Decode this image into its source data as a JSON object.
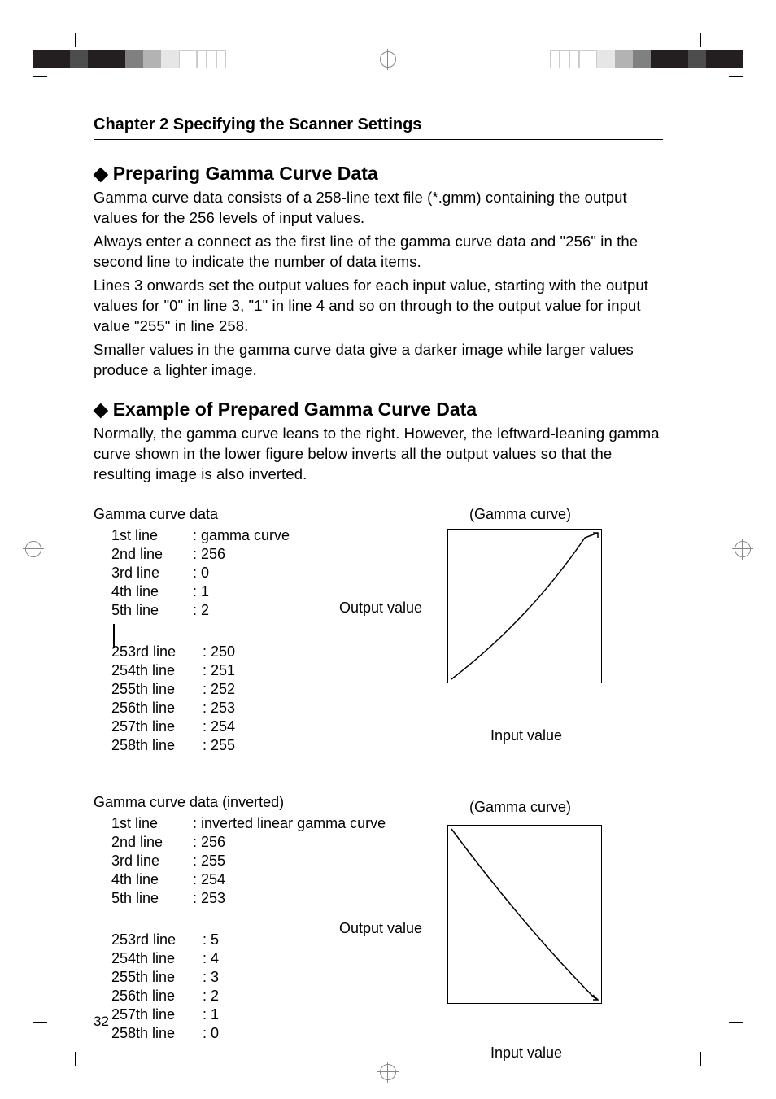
{
  "header": {
    "chapter_title": "Chapter 2 Specifying the Scanner Settings"
  },
  "section1": {
    "heading": "Preparing Gamma Curve Data",
    "p1": "Gamma curve data consists of a 258-line text file (*.gmm) containing the output values for the 256 levels of input values.",
    "p2": "Always enter a connect as the first line of the gamma curve data and \"256\" in the second line to indicate the number of data items.",
    "p3": "Lines 3 onwards set the output values for each input value, starting with the output values for \"0\" in line 3, \"1\" in line 4 and so on through to the output value for input value \"255\" in line 258.",
    "p4": "Smaller values in the gamma curve data give a darker image while larger values produce a lighter image."
  },
  "section2": {
    "heading": "Example of Prepared Gamma Curve Data",
    "p1": "Normally, the gamma curve leans to the right. However, the leftward-leaning gamma curve shown in the lower figure below inverts all the output values so that the resulting image is also inverted."
  },
  "fig1": {
    "title": "Gamma curve data",
    "curve_label": "(Gamma curve)",
    "out_label": "Output value",
    "in_label": "Input value",
    "lines_top": [
      {
        "k": "1st line",
        "v": "gamma curve"
      },
      {
        "k": "2nd line",
        "v": "256"
      },
      {
        "k": "3rd line",
        "v": "0"
      },
      {
        "k": "4th line",
        "v": "1"
      },
      {
        "k": "5th line",
        "v": "2"
      }
    ],
    "lines_bottom": [
      {
        "k": "253rd line",
        "v": "250"
      },
      {
        "k": "254th line",
        "v": "251"
      },
      {
        "k": "255th line",
        "v": "252"
      },
      {
        "k": "256th line",
        "v": "253"
      },
      {
        "k": "257th line",
        "v": "254"
      },
      {
        "k": "258th line",
        "v": "255"
      }
    ]
  },
  "fig2": {
    "title": "Gamma curve data (inverted)",
    "curve_label": "(Gamma curve)",
    "out_label": "Output value",
    "in_label": "Input value",
    "lines_top": [
      {
        "k": "1st line",
        "v": "inverted linear gamma curve"
      },
      {
        "k": "2nd line",
        "v": "256"
      },
      {
        "k": "3rd line",
        "v": "255"
      },
      {
        "k": "4th line",
        "v": "254"
      },
      {
        "k": "5th line",
        "v": "253"
      }
    ],
    "lines_bottom": [
      {
        "k": "253rd line",
        "v": "5"
      },
      {
        "k": "254th line",
        "v": "4"
      },
      {
        "k": "255th line",
        "v": "3"
      },
      {
        "k": "256th line",
        "v": "2"
      },
      {
        "k": "257th line",
        "v": "1"
      },
      {
        "k": "258th line",
        "v": "0"
      }
    ]
  },
  "page_number": "32",
  "chart_data": [
    {
      "type": "line",
      "title": "(Gamma curve)",
      "xlabel": "Input value",
      "ylabel": "Output value",
      "x": [
        0,
        255
      ],
      "series": [
        {
          "name": "gamma curve",
          "values": [
            0,
            255
          ]
        }
      ],
      "xlim": [
        0,
        255
      ],
      "ylim": [
        0,
        255
      ]
    },
    {
      "type": "line",
      "title": "(Gamma curve)",
      "xlabel": "Input value",
      "ylabel": "Output value",
      "x": [
        0,
        255
      ],
      "series": [
        {
          "name": "inverted linear gamma curve",
          "values": [
            255,
            0
          ]
        }
      ],
      "xlim": [
        0,
        255
      ],
      "ylim": [
        0,
        255
      ]
    }
  ],
  "colorbar": [
    "#231f20",
    "#4d4d4d",
    "#808080",
    "#b3b3b3",
    "#e6e6e6",
    "#ffffff"
  ]
}
